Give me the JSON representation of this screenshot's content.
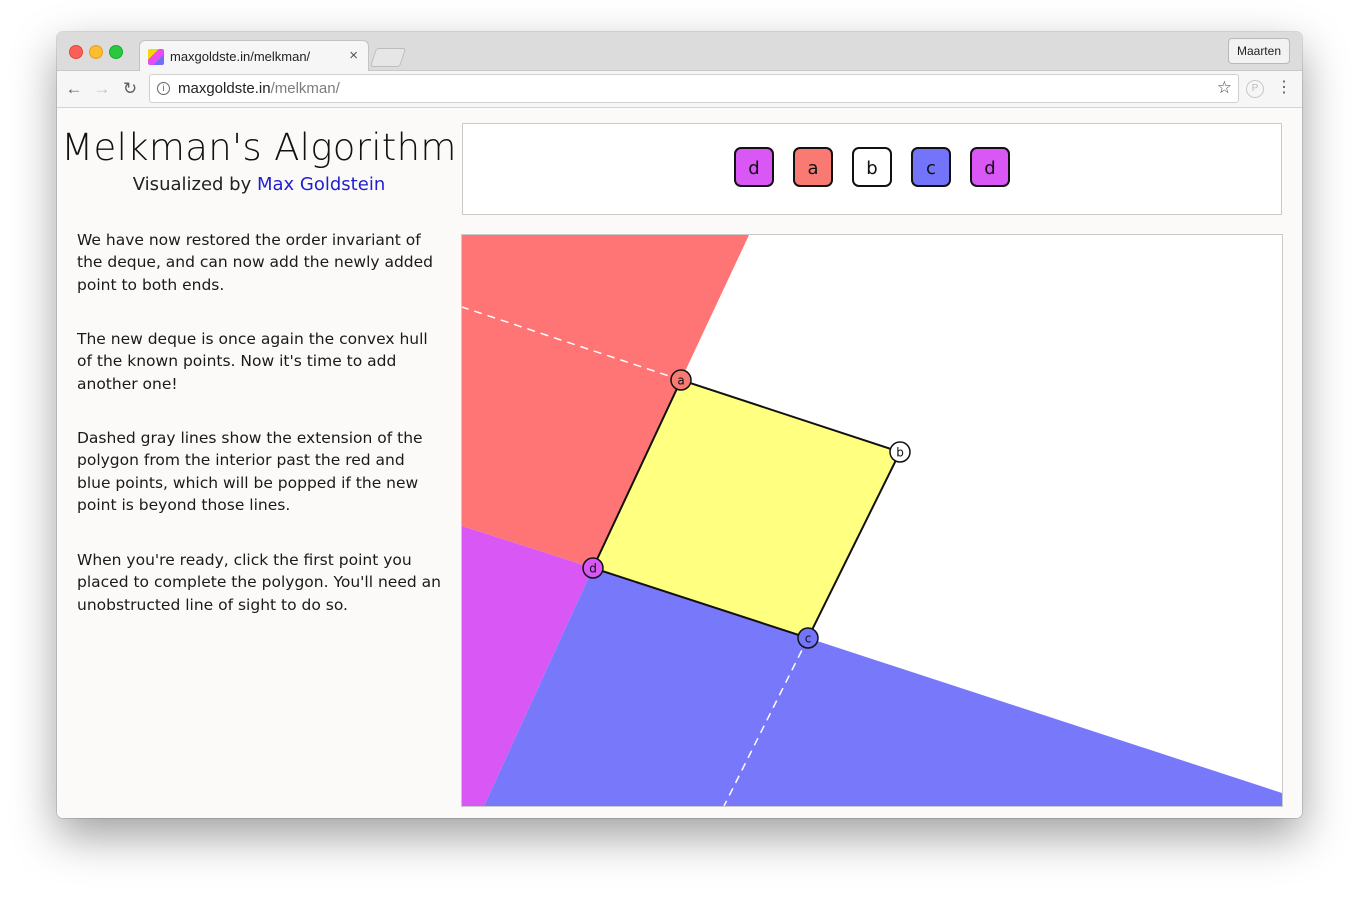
{
  "browser": {
    "tab_title": "maxgoldste.in/melkman/",
    "tab_close": "×",
    "profile_name": "Maarten",
    "url_host": "maxgoldste.in",
    "url_path": "/melkman/",
    "back_icon": "←",
    "forward_icon": "→",
    "reload_icon": "↻",
    "star_icon": "☆",
    "menu_icon": "⋮",
    "ext_icon": "P",
    "info_icon": "i"
  },
  "page": {
    "title": "Melkman's Algorithm",
    "byline_prefix": "Visualized by ",
    "byline_link": "Max Goldstein",
    "paragraphs": [
      "We have now restored the order invariant of the deque, and can now add the newly added point to both ends.",
      "The new deque is once again the convex hull of the known points. Now it's time to add another one!",
      "Dashed gray lines show the extension of the polygon from the interior past the red and blue points, which will be popped if the new point is beyond those lines.",
      "When you're ready, click the first point you placed to complete the polygon. You'll need an unobstructed line of sight to do so."
    ]
  },
  "deque": [
    {
      "label": "d",
      "color": "#d957f5"
    },
    {
      "label": "a",
      "color": "#f97a72"
    },
    {
      "label": "b",
      "color": "#ffffff"
    },
    {
      "label": "c",
      "color": "#7474fb"
    },
    {
      "label": "d",
      "color": "#d957f5"
    }
  ],
  "points": [
    {
      "label": "a",
      "color": "#f97a72"
    },
    {
      "label": "b",
      "color": "#ffffff"
    },
    {
      "label": "c",
      "color": "#7474fb"
    },
    {
      "label": "d",
      "color": "#d957f5"
    }
  ],
  "colors": {
    "red_region": "#ff7575",
    "blue_region": "#7878fb",
    "magenta_region": "#d957f5",
    "hull_fill": "#ffff80",
    "link": "#1f1fd0"
  }
}
